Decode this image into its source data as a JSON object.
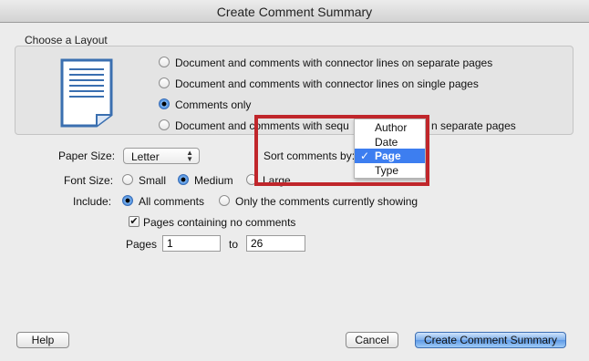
{
  "window": {
    "title": "Create Comment Summary"
  },
  "layout": {
    "group_label": "Choose a Layout",
    "options": [
      "Document and comments with connector lines on separate pages",
      "Document and comments with connector lines on single pages",
      "Comments only",
      "Document and comments with sequ",
      "n separate pages"
    ],
    "selected_index": 2
  },
  "paper_size": {
    "label": "Paper Size:",
    "value": "Letter",
    "arrows": "▲\n▼"
  },
  "font_size": {
    "label": "Font Size:",
    "options": [
      "Small",
      "Medium",
      "Large"
    ],
    "selected_index": 1
  },
  "include": {
    "label": "Include:",
    "options": [
      "All comments",
      "Only the comments currently showing"
    ],
    "selected_index": 0
  },
  "no_comments_pages": {
    "label": "Pages containing no comments",
    "checked": true,
    "check_glyph": "✔"
  },
  "pages_range": {
    "label": "Pages",
    "from": "1",
    "to_label": "to",
    "to": "26"
  },
  "sort": {
    "label": "Sort comments by:",
    "menu_items": [
      "Author",
      "Date",
      "Page",
      "Type"
    ],
    "selected_index": 2,
    "check_glyph": "✓"
  },
  "buttons": {
    "help": "Help",
    "cancel": "Cancel",
    "create": "Create Comment Summary"
  },
  "colors": {
    "highlight": "#c0262b",
    "menu_selected": "#3d7ef0",
    "doc_icon": "#3a6fb0"
  }
}
